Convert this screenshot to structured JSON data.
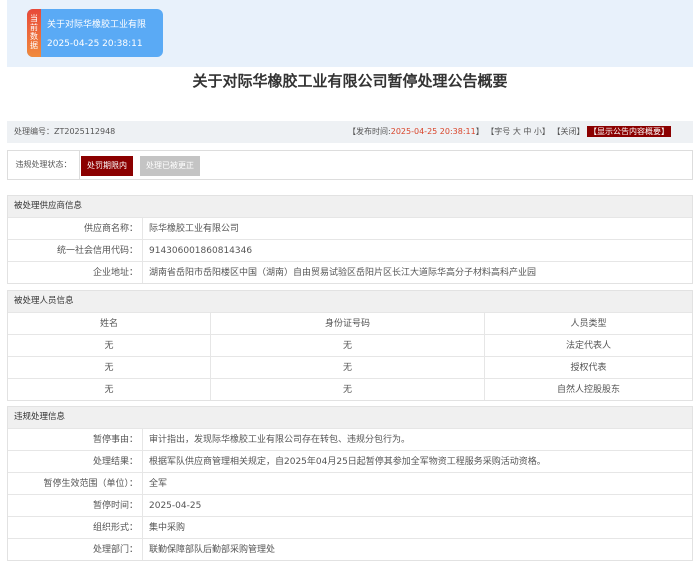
{
  "banner": {
    "tag": "当前数据",
    "title": "关于对际华橡胶工业有限",
    "time": "2025-04-25 20:38:11"
  },
  "page_title": "关于对际华橡胶工业有限公司暂停处理公告概要",
  "info": {
    "number_label": "处理编号：ZT2025112948",
    "publish_label": "【发布时间:",
    "publish_time": "2025-04-25 20:38:11",
    "publish_end": "】",
    "font_label": "【字号",
    "font_large": "大",
    "font_mid": "中",
    "font_small": "小",
    "font_end": "】",
    "close": "【关闭】",
    "show_summary": "【显示公告内容概要】"
  },
  "status": {
    "label": "违规处理状态：",
    "active": "处罚期限内",
    "inactive": "处理已被更正"
  },
  "supplier": {
    "header": "被处理供应商信息",
    "rows": [
      {
        "k": "供应商名称：",
        "v": "际华橡胶工业有限公司"
      },
      {
        "k": "统一社会信用代码：",
        "v": "914306001860814346"
      },
      {
        "k": "企业地址：",
        "v": "湖南省岳阳市岳阳楼区中国（湖南）自由贸易试验区岳阳片区长江大道际华高分子材料高科产业园"
      }
    ]
  },
  "personnel": {
    "header": "被处理人员信息",
    "columns": [
      "姓名",
      "身份证号码",
      "人员类型"
    ],
    "rows": [
      [
        "无",
        "无",
        "法定代表人"
      ],
      [
        "无",
        "无",
        "授权代表"
      ],
      [
        "无",
        "无",
        "自然人控股股东"
      ]
    ]
  },
  "violation": {
    "header": "违规处理信息",
    "rows": [
      {
        "k": "暂停事由：",
        "v": "审计指出，发现际华橡胶工业有限公司存在转包、违规分包行为。"
      },
      {
        "k": "处理结果：",
        "v": "根据军队供应商管理相关规定，自2025年04月25日起暂停其参加全军物资工程服务采购活动资格。"
      },
      {
        "k": "暂停生效范围（单位）：",
        "v": "全军"
      },
      {
        "k": "暂停时间：",
        "v": "2025-04-25"
      },
      {
        "k": "组织形式：",
        "v": "集中采购"
      },
      {
        "k": "处理部门：",
        "v": "联勤保障部队后勤部采购管理处"
      }
    ]
  }
}
